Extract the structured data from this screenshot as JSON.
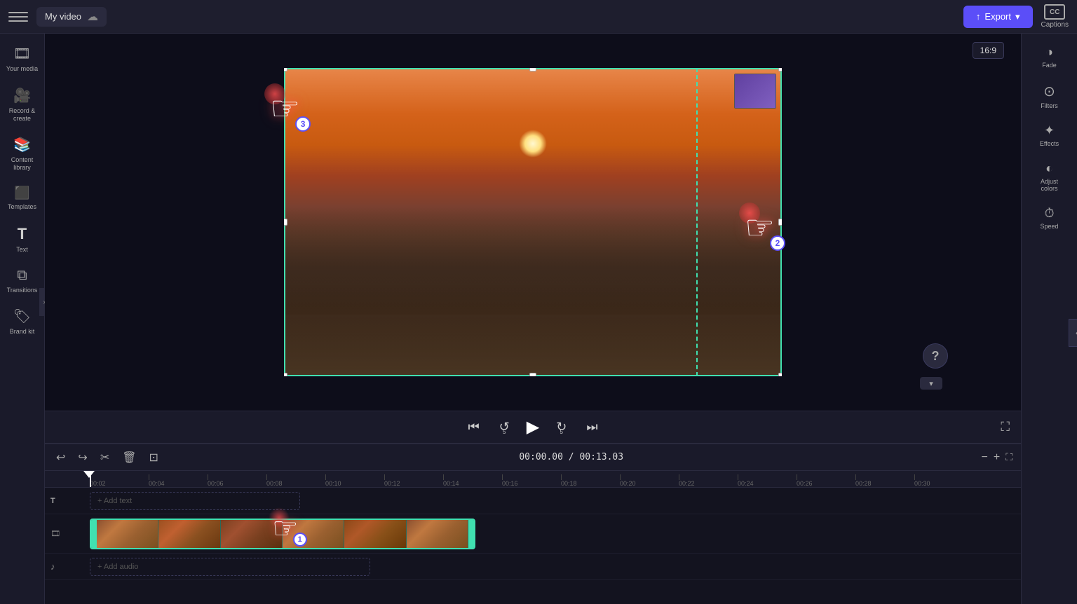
{
  "topbar": {
    "menu_label": "Menu",
    "title": "My video",
    "cloud_icon": "☁",
    "export_label": "Export",
    "export_icon": "↑",
    "captions_label": "Captions",
    "captions_cc": "CC"
  },
  "sidebar": {
    "items": [
      {
        "id": "your-media",
        "icon": "🎞",
        "label": "Your media"
      },
      {
        "id": "record-create",
        "icon": "🎥",
        "label": "Record &\ncreate"
      },
      {
        "id": "content-library",
        "icon": "📚",
        "label": "Content\nlibrary"
      },
      {
        "id": "templates",
        "icon": "⬛",
        "label": "Templates"
      },
      {
        "id": "text",
        "icon": "T",
        "label": "Text"
      },
      {
        "id": "transitions",
        "icon": "⧉",
        "label": "Transitions"
      },
      {
        "id": "brand-kit",
        "icon": "🏷",
        "label": "Brand kit"
      }
    ]
  },
  "right_sidebar": {
    "items": [
      {
        "id": "fade",
        "icon": "◑",
        "label": "Fade"
      },
      {
        "id": "filters",
        "icon": "⊙",
        "label": "Filters"
      },
      {
        "id": "effects",
        "icon": "✦",
        "label": "Effects"
      },
      {
        "id": "adjust-colors",
        "icon": "◐",
        "label": "Adjust\ncolors"
      },
      {
        "id": "speed",
        "icon": "⏱",
        "label": "Speed"
      }
    ]
  },
  "preview": {
    "aspect_ratio": "16:9"
  },
  "playback": {
    "skip_back_icon": "⏮",
    "rewind_icon": "↩",
    "play_icon": "▶",
    "forward_icon": "↪",
    "skip_forward_icon": "⏭",
    "fullscreen_icon": "⛶"
  },
  "timeline": {
    "toolbar": {
      "undo_icon": "↩",
      "redo_icon": "↪",
      "cut_icon": "✂",
      "delete_icon": "🗑",
      "caption_icon": "⊡",
      "time_current": "00:00.00",
      "time_total": "00:13.03",
      "zoom_out_icon": "−",
      "zoom_in_icon": "+",
      "expand_icon": "⛶"
    },
    "ruler": {
      "marks": [
        "00:02",
        "00:04",
        "00:06",
        "00:08",
        "00:10",
        "00:12",
        "00:14",
        "00:16",
        "00:18",
        "00:20",
        "00:22",
        "00:24",
        "00:26",
        "00:28",
        "00:30"
      ]
    },
    "tracks": {
      "text_label": "T",
      "add_text": "+ Add text",
      "video_label": "🎞",
      "audio_label": "♪",
      "add_audio": "+ Add audio"
    }
  },
  "cursors": [
    {
      "id": 1,
      "number": "1"
    },
    {
      "id": 2,
      "number": "2"
    },
    {
      "id": 3,
      "number": "3"
    }
  ],
  "help": {
    "icon": "?"
  }
}
